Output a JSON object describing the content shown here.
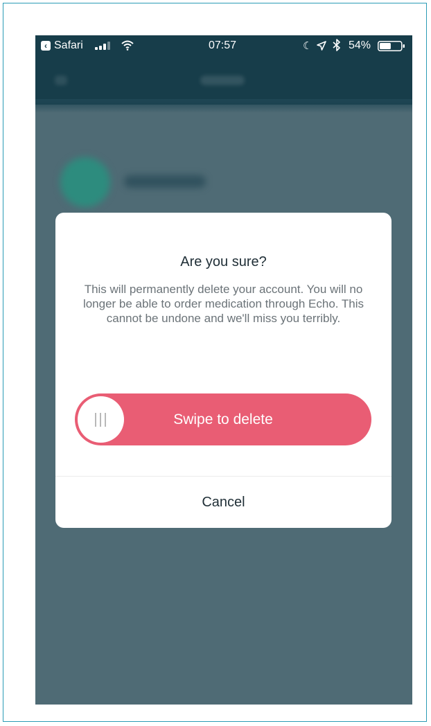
{
  "status_bar": {
    "back_app": "Safari",
    "time": "07:57",
    "battery_percent": "54%",
    "battery_level": 0.54,
    "icons": [
      "back-badge-icon",
      "signal-icon",
      "wifi-icon",
      "moon-icon",
      "location-icon",
      "bluetooth-icon",
      "battery-icon"
    ]
  },
  "dialog": {
    "title": "Are you sure?",
    "message": "This will permanently delete your account. You will no longer be able to order medication through Echo. This cannot be undone and we'll miss you terribly.",
    "swipe_label": "Swipe to delete",
    "cancel_label": "Cancel"
  },
  "colors": {
    "overlay": "#4f6b75",
    "nav_bar": "#173d4a",
    "swipe_track": "#e95d74",
    "dialog_background": "#ffffff",
    "avatar": "#2d8c7e"
  }
}
